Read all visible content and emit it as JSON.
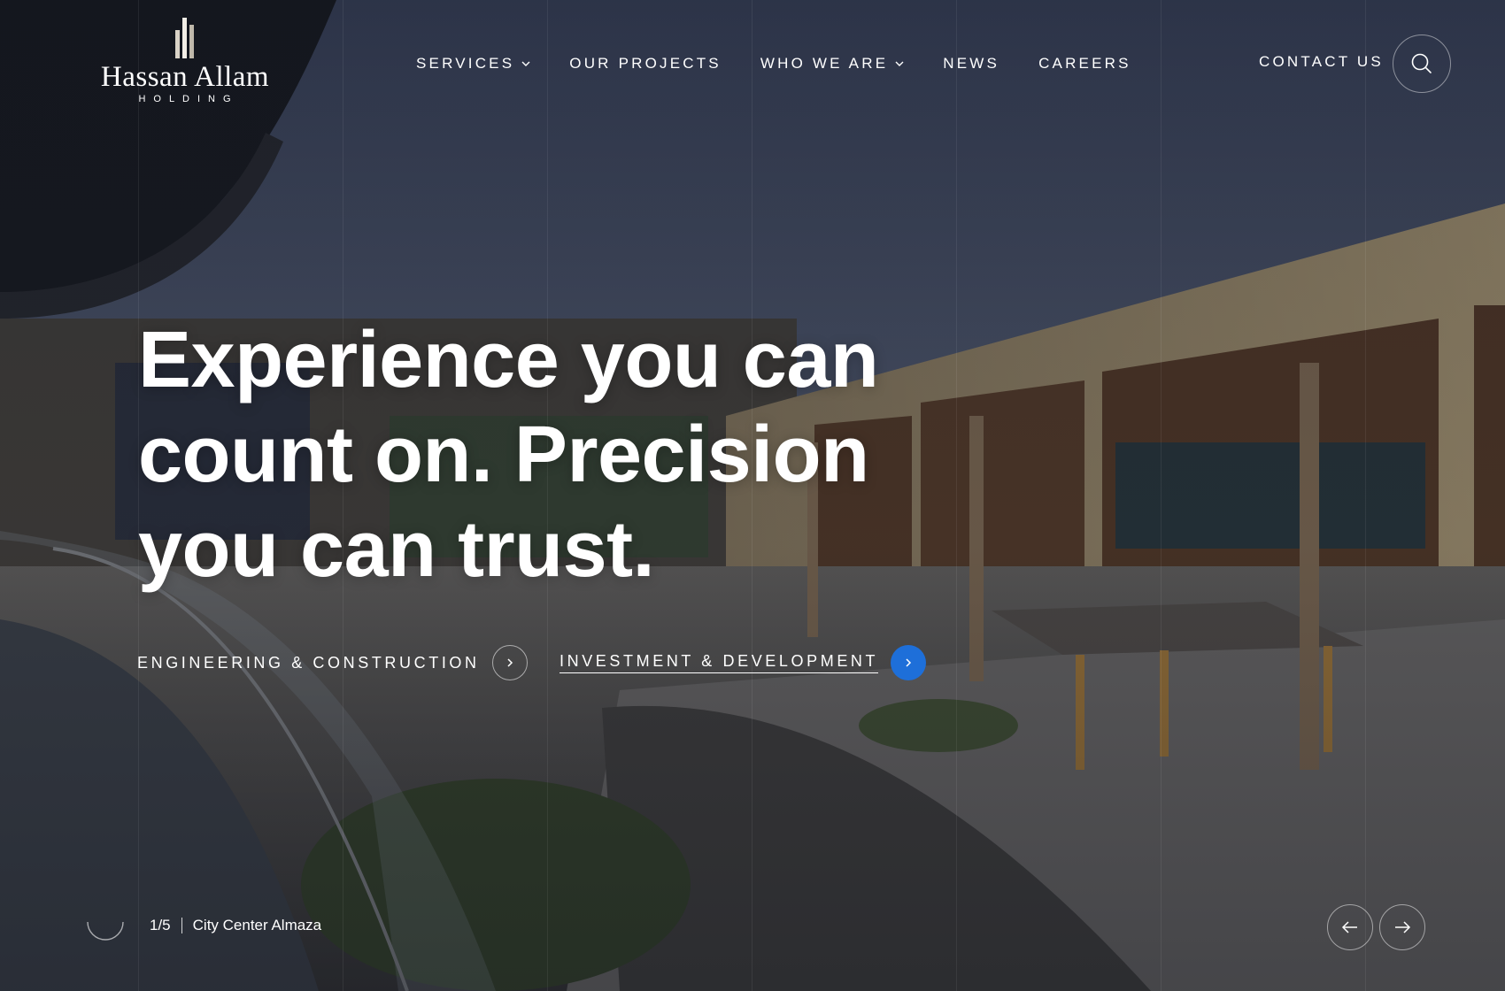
{
  "brand": {
    "name": "Hassan Allam",
    "subtitle": "HOLDING"
  },
  "nav": {
    "items": [
      {
        "label": "SERVICES",
        "has_dropdown": true
      },
      {
        "label": "OUR PROJECTS",
        "has_dropdown": false
      },
      {
        "label": "WHO WE ARE",
        "has_dropdown": true
      },
      {
        "label": "NEWS",
        "has_dropdown": false
      },
      {
        "label": "CAREERS",
        "has_dropdown": false
      }
    ],
    "contact_label": "CONTACT US",
    "search_icon": "search-icon"
  },
  "hero": {
    "headline_lines": [
      "Experience you can",
      "count on. Precision",
      "you can trust."
    ],
    "sectors": [
      {
        "label": "ENGINEERING & CONSTRUCTION",
        "active": false,
        "icon": "chevron-right-icon"
      },
      {
        "label": "INVESTMENT & DEVELOPMENT",
        "active": true,
        "icon": "chevron-right-icon"
      }
    ],
    "slide": {
      "counter": "1/5",
      "caption": "City Center Almaza"
    },
    "arrows": {
      "prev_icon": "arrow-left-icon",
      "next_icon": "arrow-right-icon"
    }
  },
  "colors": {
    "accent": "#1e6fd9",
    "sky": "#4a5570",
    "overlay": "#141a26"
  }
}
